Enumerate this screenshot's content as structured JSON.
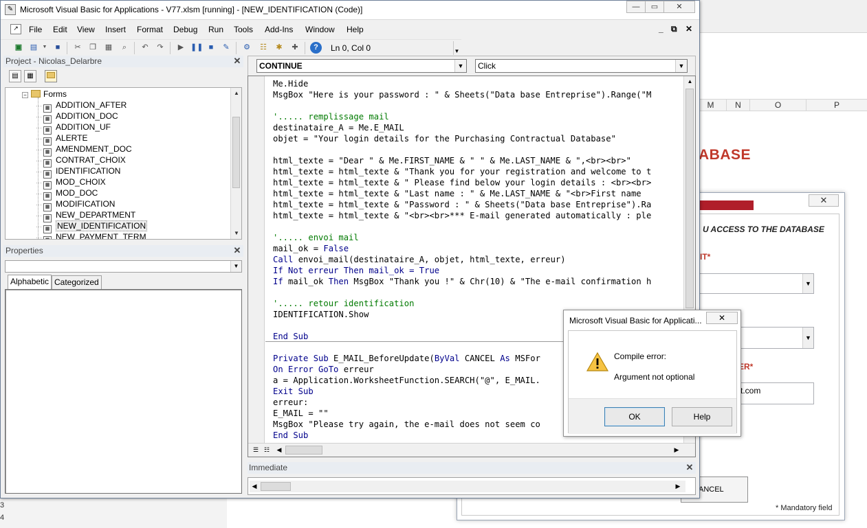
{
  "vbe": {
    "title": "Microsoft Visual Basic for Applications - V77.xlsm [running] - [NEW_IDENTIFICATION (Code)]",
    "menu": [
      "File",
      "Edit",
      "View",
      "Insert",
      "Format",
      "Debug",
      "Run",
      "Tools",
      "Add-Ins",
      "Window",
      "Help"
    ],
    "position": "Ln 0, Col 0"
  },
  "project": {
    "header": "Project - Nicolas_Delarbre",
    "folder": "Forms",
    "items": [
      "ADDITION_AFTER",
      "ADDITION_DOC",
      "ADDITION_UF",
      "ALERTE",
      "AMENDMENT_DOC",
      "CONTRAT_CHOIX",
      "IDENTIFICATION",
      "MOD_CHOIX",
      "MOD_DOC",
      "MODIFICATION",
      "NEW_DEPARTMENT",
      "NEW_IDENTIFICATION",
      "NEW_PAYMENT_TERM"
    ],
    "selected_index": 11
  },
  "properties": {
    "header": "Properties",
    "tab_alphabetic": "Alphabetic",
    "tab_categorized": "Categorized"
  },
  "code": {
    "object_combo": "CONTINUE",
    "procedure_combo": "Click",
    "lines": [
      {
        "t": "Me.Hide",
        "k": "n"
      },
      {
        "t": "MsgBox \"Here is your password : \" & Sheets(\"Data base Entreprise\").Range(\"M",
        "k": "n"
      },
      {
        "t": "",
        "k": "n"
      },
      {
        "t": "'..... remplissage mail",
        "k": "cm"
      },
      {
        "t": "destinataire_A = Me.E_MAIL",
        "k": "n"
      },
      {
        "t": "objet = \"Your login details for the Purchasing Contractual Database\"",
        "k": "n"
      },
      {
        "t": "",
        "k": "n"
      },
      {
        "t": "html_texte = \"Dear \" & Me.FIRST_NAME & \" \" & Me.LAST_NAME & \",<br><br>\"",
        "k": "n"
      },
      {
        "t": "html_texte = html_texte & \"Thank you for your registration and welcome to t",
        "k": "n"
      },
      {
        "t": "html_texte = html_texte & \" Please find below your login details : <br><br>",
        "k": "n"
      },
      {
        "t": "html_texte = html_texte & \"Last name : \" & Me.LAST_NAME & \"<br>First name",
        "k": "n"
      },
      {
        "t": "html_texte = html_texte & \"Password : \" & Sheets(\"Data base Entreprise\").Ra",
        "k": "n"
      },
      {
        "t": "html_texte = html_texte & \"<br><br>*** E-mail generated automatically : ple",
        "k": "n"
      },
      {
        "t": "",
        "k": "n"
      },
      {
        "t": "'..... envoi mail",
        "k": "cm"
      },
      {
        "t": "mail_ok = False",
        "k": "mix1"
      },
      {
        "t": "Call envoi_mail(destinataire_A, objet, html_texte, erreur)",
        "k": "mix2"
      },
      {
        "t": "If Not erreur Then mail_ok = True",
        "k": "kw"
      },
      {
        "t": "If mail_ok Then MsgBox \"Thank you !\" & Chr(10) & \"The e-mail confirmation h",
        "k": "mix3"
      },
      {
        "t": "",
        "k": "n"
      },
      {
        "t": "'..... retour identification",
        "k": "cm"
      },
      {
        "t": "IDENTIFICATION.Show",
        "k": "n"
      },
      {
        "t": "",
        "k": "n"
      },
      {
        "t": "End Sub",
        "k": "kw"
      },
      {
        "t": "",
        "k": "n"
      },
      {
        "t": "Private Sub E_MAIL_BeforeUpdate(ByVal CANCEL As MSFor",
        "k": "mix4"
      },
      {
        "t": "On Error GoTo erreur",
        "k": "mix5"
      },
      {
        "t": "a = Application.WorksheetFunction.SEARCH(\"@\", E_MAIL.",
        "k": "n"
      },
      {
        "t": "Exit Sub",
        "k": "kw"
      },
      {
        "t": "erreur:",
        "k": "n"
      },
      {
        "t": "E_MAIL = \"\"",
        "k": "n"
      },
      {
        "t": "MsgBox \"Please try again, the e-mail does not seem co",
        "k": "n"
      },
      {
        "t": "End Sub",
        "k": "kw"
      }
    ]
  },
  "immediate": {
    "header": "Immediate"
  },
  "dialog": {
    "title": "Microsoft Visual Basic for Applicati...",
    "message_title": "Compile error:",
    "message_body": "Argument not optional",
    "ok_label": "OK",
    "help_label": "Help"
  },
  "excel": {
    "columns": [
      "M",
      "N",
      "O",
      "P"
    ],
    "form_title_fragment": "ABASE",
    "form_heading_fragment": "U ACCESS TO THE DATABASE",
    "label_fragment_1": "IT*",
    "label_fragment_2": "ER*",
    "email_fragment": "st.com",
    "cancel_fragment": "ANCEL",
    "mandatory": "* Mandatory field",
    "row_fragments": [
      "3",
      "4"
    ]
  }
}
